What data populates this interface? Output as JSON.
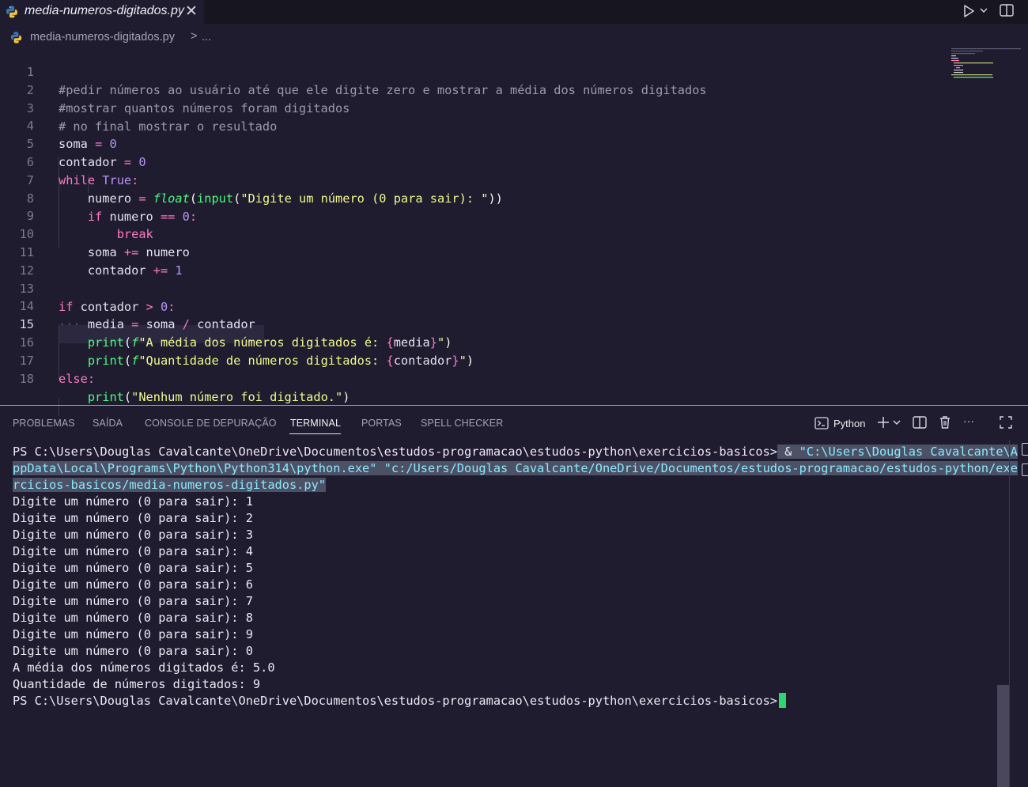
{
  "tab": {
    "filename": "media-numeros-digitados.py",
    "close": "✕"
  },
  "breadcrumb": {
    "file": "media-numeros-digitados.py",
    "sep": ">",
    "more": "..."
  },
  "editor": {
    "line_numbers": [
      "1",
      "2",
      "3",
      "4",
      "5",
      "6",
      "7",
      "8",
      "9",
      "10",
      "11",
      "12",
      "13",
      "14",
      "15",
      "16",
      "17",
      "18"
    ],
    "active_line": "15",
    "comments": {
      "l1": "#pedir números ao usuário até que ele digite zero e mostrar a média dos números digitados",
      "l2": "#mostrar quantos números foram digitados",
      "l3": "# no final mostrar o resultado"
    },
    "tokens": {
      "soma": "soma",
      "contador": "contador",
      "numero": "numero",
      "media": "media",
      "eq": "=",
      "eqeq": "==",
      "pluseq": "+=",
      "gt": ">",
      "div": "/",
      "zero": "0",
      "one": "1",
      "while": "while",
      "true": "True",
      "colon": ":",
      "float": "float",
      "input": "input",
      "lp": "(",
      "rp": ")",
      "rpp": "))",
      "if": "if",
      "break": "break",
      "else": "else",
      "print": "print",
      "f": "f",
      "prompt_str": "\"Digite um número (0 para sair): \"",
      "media_str_a": "\"A média dos números digitados é: ",
      "qtd_str_a": "\"Quantidade de números digitados: ",
      "lb": "{",
      "rb": "}",
      "q": "\"",
      "none_str": "\"Nenhum número foi digitado.\"",
      "ws_dots": "···"
    }
  },
  "panel": {
    "tabs": [
      "PROBLEMAS",
      "SAÍDA",
      "CONSOLE DE DEPURAÇÃO",
      "TERMINAL",
      "PORTAS",
      "SPELL CHECKER"
    ],
    "profile": "Python",
    "more": "···"
  },
  "terminal": {
    "prompt1": "PS C:\\Users\\Douglas Cavalcante\\OneDrive\\Documentos\\estudos-programacao\\estudos-python\\exercicios-basicos>",
    "cmd_amp": "&",
    "cmd_line1": "\"C:\\Users\\Douglas Cavalcante\\A",
    "cmd_line2": "ppData\\Local\\Programs\\Python\\Python314\\python.exe\" \"c:/Users/Douglas Cavalcante/OneDrive/Documentos/estudos-programacao/estudos-python/exe",
    "cmd_line3": "rcicios-basicos/media-numeros-digitados.py\"",
    "outputs": [
      "Digite um número (0 para sair): 1",
      "Digite um número (0 para sair): 2",
      "Digite um número (0 para sair): 3",
      "Digite um número (0 para sair): 4",
      "Digite um número (0 para sair): 5",
      "Digite um número (0 para sair): 6",
      "Digite um número (0 para sair): 7",
      "Digite um número (0 para sair): 8",
      "Digite um número (0 para sair): 9",
      "Digite um número (0 para sair): 0",
      "A média dos números digitados é: 5.0",
      "Quantidade de números digitados: 9"
    ],
    "prompt2": "PS C:\\Users\\Douglas Cavalcante\\OneDrive\\Documentos\\estudos-programacao\\estudos-python\\exercicios-basicos>"
  },
  "colors": {
    "background": "#1e1c2e",
    "accent": "#a58fd6",
    "cursor": "#2ed66f"
  }
}
